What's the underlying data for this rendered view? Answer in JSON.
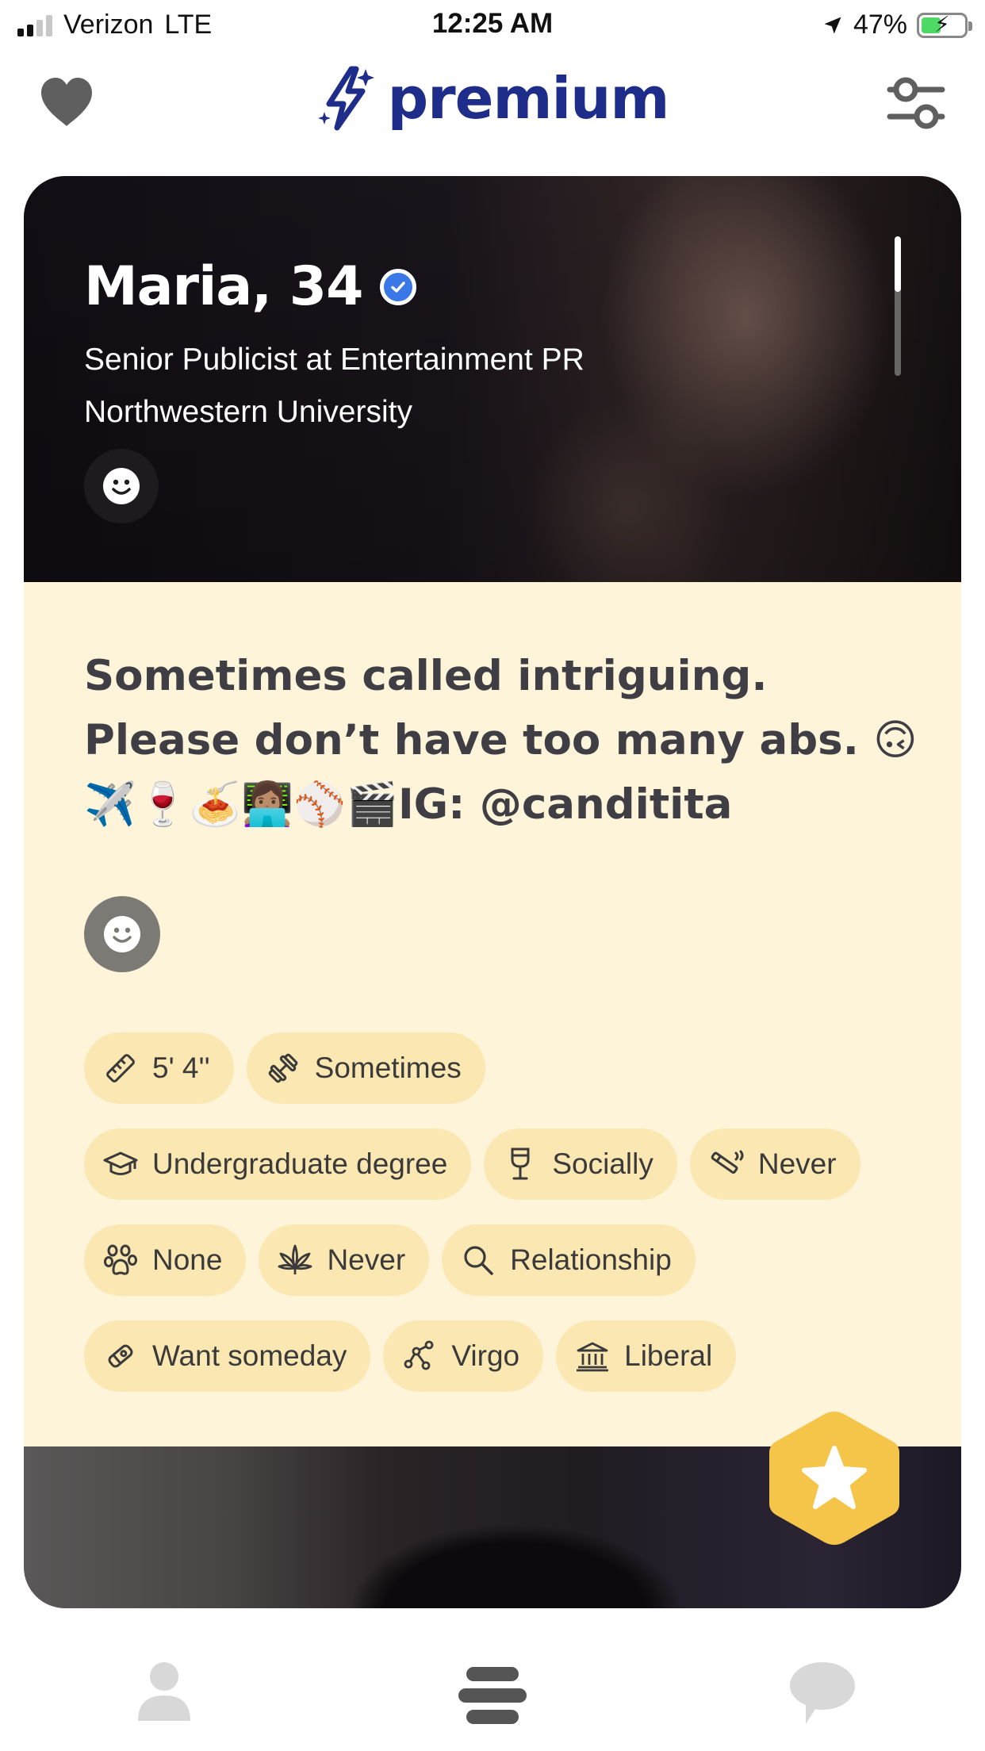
{
  "status_bar": {
    "carrier": "Verizon",
    "network": "LTE",
    "time": "12:25 AM",
    "battery": "47%",
    "battery_level": 0.47
  },
  "header": {
    "brand": "premium",
    "left_icon": "heart-icon",
    "right_icon": "filter-sliders-icon",
    "brand_color": "#1f2d8a"
  },
  "profile": {
    "name_age": "Maria, 34",
    "verified": true,
    "job": "Senior Publicist at Entertainment PR",
    "school": "Northwestern University",
    "bio_lines": [
      "Sometimes called intriguing.",
      "Please don’t have too many abs. 🙃",
      "✈️🍷🍝👩🏽‍💻⚾🎬IG: @canditita"
    ],
    "chips": [
      [
        {
          "icon": "ruler-icon",
          "label": "5' 4''"
        },
        {
          "icon": "dumbbell-icon",
          "label": "Sometimes"
        }
      ],
      [
        {
          "icon": "graduation-cap-icon",
          "label": "Undergraduate degree"
        },
        {
          "icon": "wine-glass-icon",
          "label": "Socially"
        },
        {
          "icon": "cigarette-icon",
          "label": "Never"
        }
      ],
      [
        {
          "icon": "paw-icon",
          "label": "None"
        },
        {
          "icon": "cannabis-leaf-icon",
          "label": "Never"
        },
        {
          "icon": "magnifier-icon",
          "label": "Relationship"
        }
      ],
      [
        {
          "icon": "pacifier-icon",
          "label": "Want someday"
        },
        {
          "icon": "constellation-icon",
          "label": "Virgo"
        },
        {
          "icon": "capitol-building-icon",
          "label": "Liberal"
        }
      ]
    ]
  },
  "colors": {
    "card_background": "#fdf4d9",
    "chip_background": "#fbe7b1",
    "super_like": "#f5c54a",
    "verified_badge": "#3a78e8"
  },
  "bottom_nav": {
    "items": [
      "profile-icon",
      "discover-icon",
      "chat-bubble-icon"
    ]
  }
}
